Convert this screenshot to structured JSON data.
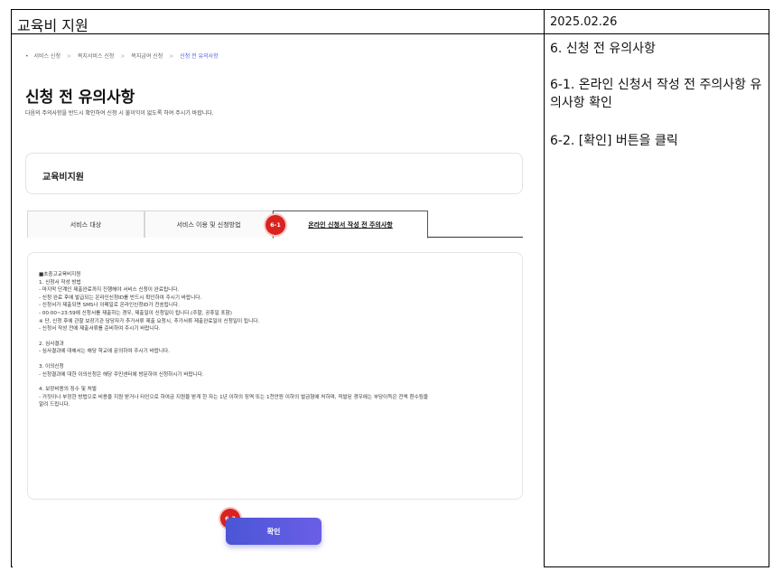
{
  "header": {
    "title": "교육비 지원",
    "date": "2025.02.26"
  },
  "notes": [
    "6. 신청 전 유의사항",
    "6-1. 온라인 신청서 작성 전 주의사항 유의사항 확인",
    "6-2. [확인] 버튼을 클릭"
  ],
  "breadcrumb": {
    "items": [
      "서비스 신청",
      "복지서비스 신청",
      "복지급여 신청",
      "신청 전 유의사항"
    ],
    "separator": ">"
  },
  "page": {
    "heading": "신청 전 유의사항",
    "description": "다음의 주의사항을 반드시 확인하여 신청 시 불이익이 없도록 하여 주시기 바랍니다."
  },
  "card": {
    "title": "교육비지원"
  },
  "tabs": [
    {
      "label": "서비스 대상",
      "active": false
    },
    {
      "label": "서비스 이용 및 신청방법",
      "active": false
    },
    {
      "label": "온라인 신청서 작성 전 주의사항",
      "active": true
    }
  ],
  "badges": {
    "tab": "6-1",
    "button": "6-2"
  },
  "content": {
    "lines": [
      "■초중고교육비지원",
      "1. 신청서 작성 방법",
      "- 마지막 단계인 제출완료까지 진행해야 서비스 신청이 완료됩니다.",
      "- 신청 완료 후에 발급되는 온라인신청ID를 반드시 확인하여 주시기 바랍니다.",
      "- 신청서가 제출되면 SMS나 이메일로 온라인신청ID가 전송됩니다.",
      "- 00:00~23:59에 신청서를 제출하는 경우, 제출일이 신청일이 됩니다.(주말, 공휴일 포함)",
      "※ 단, 신청 후에 관할 보장기관 담당자가 추가서류 제출 요청시, 추가서류 제출완료일이 신청일이 됩니다.",
      "- 신청서 작성 전에 제출서류를 준비하여 주시기 바랍니다.",
      "",
      "2. 심사결과",
      "- 심사결과에 대해서는 해당 학교에 문의하여 주시기 바랍니다.",
      "",
      "3. 이의신청",
      "- 신청결과에 대한 이의신청은 해당 주민센터에 방문하여 신청하시기 바랍니다.",
      "",
      "4. 보장비용의 징수 및 처벌",
      "- 거짓이나 부정한 방법으로 비용을 지원 받거나 타인으로 하여금 지원을 받게 한 자는 1년 이하의 징역 또는 1천만원 이하의 벌금형에 처하며, 적발된 경우에는 부당이득은 전액 환수됨을",
      "알려 드립니다."
    ]
  },
  "confirm_button": {
    "label": "확인"
  },
  "colors": {
    "accent": "#4a5de8",
    "badge": "#d9231f",
    "button_start": "#4b55d6",
    "button_end": "#6a5fe6"
  }
}
